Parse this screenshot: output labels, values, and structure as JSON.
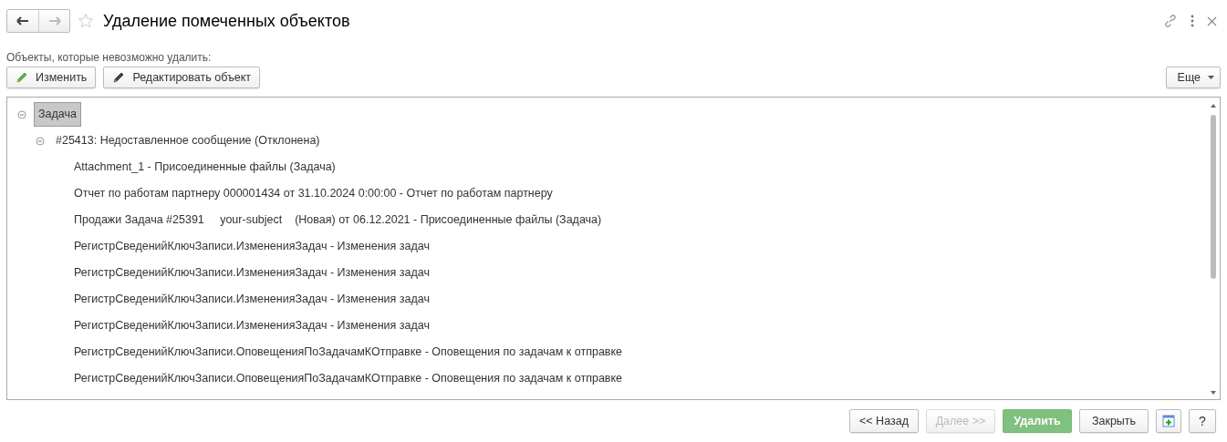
{
  "window": {
    "title": "Удаление помеченных объектов",
    "favorite": false
  },
  "section_label": "Объекты, которые невозможно удалить:",
  "toolbar": [
    {
      "label": "Изменить"
    },
    {
      "label": "Редактировать объект"
    }
  ],
  "more_button": "Еще",
  "tree": [
    {
      "label": "Задача",
      "selected": true,
      "expanded": true,
      "children": [
        {
          "label": "#25413: Недоставленное сообщение (Отклонена)",
          "selected": false,
          "expanded": true,
          "children": [
            {
              "label": "Attachment_1 - Присоединенные файлы (Задача)",
              "selected": false
            },
            {
              "label": "Отчет по работам партнеру 000001434 от 31.10.2024 0:00:00 - Отчет по работам партнеру",
              "selected": false
            },
            {
              "label": "Продажи Задача #25391     your-subject    (Новая) от 06.12.2021 - Присоединенные файлы (Задача)",
              "selected": false
            },
            {
              "label": "РегистрСведенийКлючЗаписи.ИзмененияЗадач - Изменения задач",
              "selected": false
            },
            {
              "label": "РегистрСведенийКлючЗаписи.ИзмененияЗадач - Изменения задач",
              "selected": false
            },
            {
              "label": "РегистрСведенийКлючЗаписи.ИзмененияЗадач - Изменения задач",
              "selected": false
            },
            {
              "label": "РегистрСведенийКлючЗаписи.ИзмененияЗадач - Изменения задач",
              "selected": false
            },
            {
              "label": "РегистрСведенийКлючЗаписи.ОповещенияПоЗадачамКОтправке - Оповещения по задачам к отправке",
              "selected": false
            },
            {
              "label": "РегистрСведенийКлючЗаписи.ОповещенияПоЗадачамКОтправке - Оповещения по задачам к отправке",
              "selected": false
            }
          ]
        }
      ]
    }
  ],
  "footer_buttons": [
    {
      "kind": "text",
      "label": "<< Назад",
      "disabled": false,
      "default": false
    },
    {
      "kind": "text",
      "label": "Далее >>",
      "disabled": true,
      "default": false
    },
    {
      "kind": "text",
      "label": "Удалить",
      "disabled": false,
      "default": true
    },
    {
      "kind": "text",
      "label": "Закрыть",
      "disabled": false,
      "default": false
    },
    {
      "kind": "icon",
      "disabled": false,
      "default": false
    },
    {
      "kind": "text",
      "label": "?",
      "disabled": false,
      "default": false
    }
  ]
}
